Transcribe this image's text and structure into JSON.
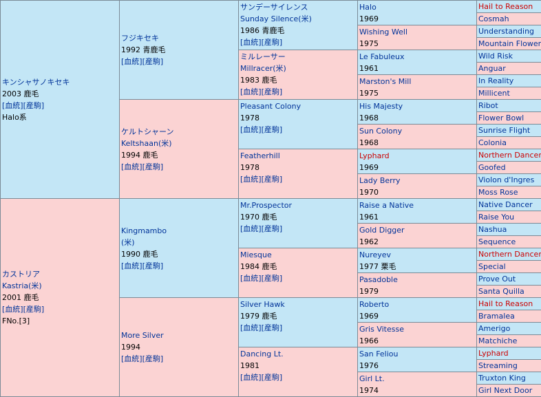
{
  "g1": {
    "sire": {
      "name": "キンシャサノキセキ",
      "year_coat": "2003 鹿毛",
      "links": "[血統][産駒]",
      "line": "Halo系"
    },
    "dam": {
      "name": "カストリア",
      "name_en": "Kastria(米)",
      "year_coat": "2001 鹿毛",
      "links": "[血統][産駒]",
      "fno": "FNo.[3]"
    }
  },
  "g2": [
    {
      "name": "フジキセキ",
      "year_coat": "1992 青鹿毛",
      "links": "[血統][産駒]"
    },
    {
      "name": "ケルトシャーン",
      "name_en": "Keltshaan(米)",
      "year_coat": "1994 鹿毛",
      "links": "[血統][産駒]"
    },
    {
      "name": "Kingmambo",
      "name_en": "(米)",
      "year_coat": "1990 鹿毛",
      "links": "[血統][産駒]"
    },
    {
      "name": "More Silver",
      "year_coat": "1994",
      "links": "[血統][産駒]"
    }
  ],
  "g3": [
    {
      "name": "サンデーサイレンス",
      "name_en": "Sunday Silence(米)",
      "year_coat": "1986 青鹿毛",
      "links": "[血統][産駒]"
    },
    {
      "name": "ミルレーサー",
      "name_en": "Millracer(米)",
      "year_coat": "1983 鹿毛",
      "links": "[血統][産駒]"
    },
    {
      "name": "Pleasant Colony",
      "year_coat": "1978",
      "links": "[血統][産駒]"
    },
    {
      "name": "Featherhill",
      "year_coat": "1978",
      "links": "[血統][産駒]"
    },
    {
      "name": "Mr.Prospector",
      "year_coat": "1970 鹿毛",
      "links": "[血統][産駒]"
    },
    {
      "name": "Miesque",
      "year_coat": "1984 鹿毛",
      "links": "[血統][産駒]"
    },
    {
      "name": "Silver Hawk",
      "year_coat": "1979 鹿毛",
      "links": "[血統][産駒]"
    },
    {
      "name": "Dancing Lt.",
      "year_coat": "1981",
      "links": "[血統][産駒]"
    }
  ],
  "g4": [
    {
      "name": "Halo",
      "year": "1969"
    },
    {
      "name": "Wishing Well",
      "year": "1975"
    },
    {
      "name": "Le Fabuleux",
      "year": "1961"
    },
    {
      "name": "Marston's Mill",
      "year": "1975"
    },
    {
      "name": "His Majesty",
      "year": "1968"
    },
    {
      "name": "Sun Colony",
      "year": "1968"
    },
    {
      "name": "Lyphard",
      "year": "1969"
    },
    {
      "name": "Lady Berry",
      "year": "1970"
    },
    {
      "name": "Raise a Native",
      "year": "1961"
    },
    {
      "name": "Gold Digger",
      "year": "1962"
    },
    {
      "name": "Nureyev",
      "year": "1977 栗毛"
    },
    {
      "name": "Pasadoble",
      "year": "1979"
    },
    {
      "name": "Roberto",
      "year": "1969"
    },
    {
      "name": "Gris Vitesse",
      "year": "1966"
    },
    {
      "name": "San Feliou",
      "year": "1976"
    },
    {
      "name": "Girl Lt.",
      "year": "1974"
    }
  ],
  "g5": [
    "Hail to Reason",
    "Cosmah",
    "Understanding",
    "Mountain Flower",
    "Wild Risk",
    "Anguar",
    "In Reality",
    "Millicent",
    "Ribot",
    "Flower Bowl",
    "Sunrise Flight",
    "Colonia",
    "Northern Dancer",
    "Goofed",
    "Violon d'Ingres",
    "Moss Rose",
    "Native Dancer",
    "Raise You",
    "Nashua",
    "Sequence",
    "Northern Dancer",
    "Special",
    "Prove Out",
    "Santa Quilla",
    "Hail to Reason",
    "Bramalea",
    "Amerigo",
    "Matchiche",
    "Lyphard",
    "Streaming",
    "Truxton King",
    "Girl Next Door"
  ],
  "inbreed_color": "#cc0000",
  "male_bg": "#c3e6f6",
  "female_bg": "#fbd3d3"
}
